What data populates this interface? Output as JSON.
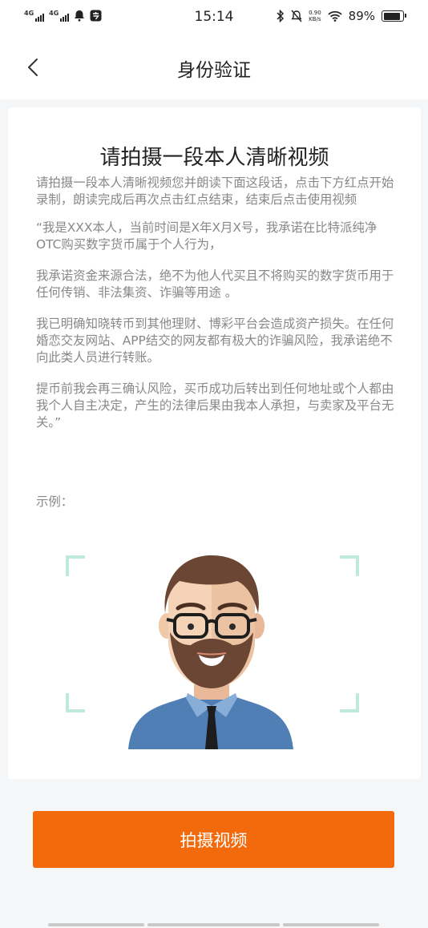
{
  "status_bar": {
    "network_1": "4G",
    "network_2": "4G",
    "time": "15:14",
    "speed_value": "0.90",
    "speed_unit": "KB/s",
    "battery": "89%"
  },
  "nav": {
    "title": "身份验证"
  },
  "card": {
    "title": "请拍摄一段本人清晰视频",
    "instruction": "请拍摄一段本人清晰视频您并朗读下面这段话，点击下方红点开始录制，朗读完成后再次点击红点结束，结束后点击使用视频",
    "statement_1": "“我是XXX本人，当前时间是X年X月X号，我承诺在比特派纯净OTC购买数字货币属于个人行为，",
    "statement_2": "我承诺资金来源合法，绝不为他人代买且不将购买的数字货币用于任何传销、非法集资、诈骗等用途 。",
    "statement_3": "我已明确知晓转币到其他理财、博彩平台会造成资产损失。在任何婚恋交友网站、APP结交的网友都有极大的诈骗风险，我承诺绝不向此类人员进行转账。",
    "statement_4": "提币前我会再三确认风险，买币成功后转出到任何地址或个人都由我个人自主决定，产生的法律后果由我本人承担，与卖家及平台无关。”",
    "example_label": "示例："
  },
  "record_button": {
    "label": "拍摄视频"
  },
  "colors": {
    "accent": "#f26a0c",
    "frame_corner": "#bfe9dc",
    "shirt": "#4f7fb5"
  }
}
